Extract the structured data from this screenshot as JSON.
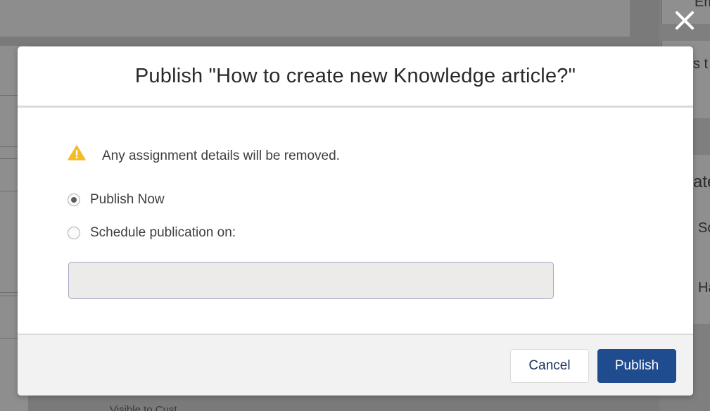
{
  "background": {
    "right_texts": [
      "Em",
      "s t",
      "ate",
      "Sc",
      "Ha"
    ],
    "bottom_text": "Visible to Cust..."
  },
  "modal": {
    "title": "Publish \"How to create new Knowledge article?\"",
    "warning": {
      "icon": "warning-icon",
      "color": "#f4bc25",
      "text": "Any assignment details will be removed."
    },
    "options": [
      {
        "label": "Publish Now",
        "selected": true
      },
      {
        "label": "Schedule publication on:",
        "selected": false
      }
    ],
    "schedule_input": {
      "value": "",
      "placeholder": ""
    },
    "buttons": {
      "cancel": "Cancel",
      "publish": "Publish"
    },
    "colors": {
      "primary": "#1f4b8f",
      "link": "#16325c"
    }
  },
  "overlay": {
    "close_icon": "close-icon"
  }
}
